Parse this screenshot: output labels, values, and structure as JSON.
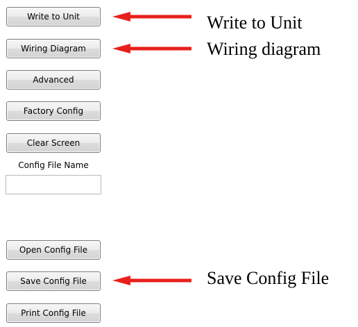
{
  "buttons": {
    "write_to_unit": "Write to Unit",
    "wiring_diagram": "Wiring Diagram",
    "advanced": "Advanced",
    "factory_config": "Factory Config",
    "clear_screen": "Clear Screen",
    "open_config_file": "Open Config File",
    "save_config_file": "Save Config File",
    "print_config_file": "Print Config File"
  },
  "config_file": {
    "label": "Config File Name",
    "value": "",
    "placeholder": ""
  },
  "annotations": {
    "write_to_unit": "Write to Unit",
    "wiring_diagram": "Wiring diagram",
    "save_config_file": "Save Config File"
  },
  "colors": {
    "arrow": "#e8201c"
  }
}
